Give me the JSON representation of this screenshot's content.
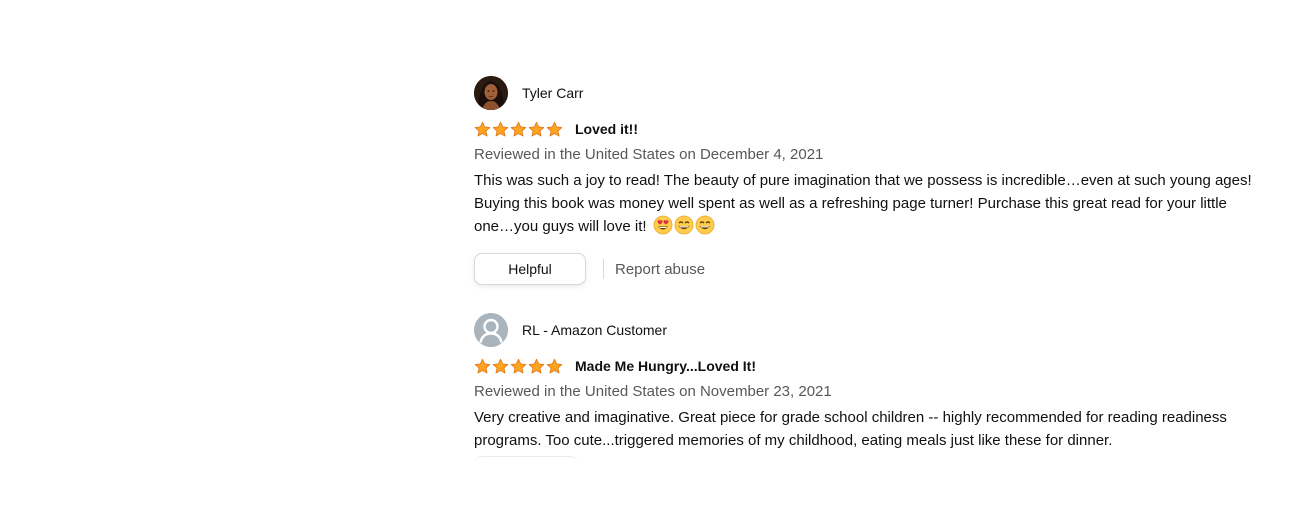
{
  "colors": {
    "star": "#FFA41C",
    "star_outline": "#DE7921",
    "text": "#0F1111",
    "secondary_text": "#565959"
  },
  "reviews": [
    {
      "author": "Tyler Carr",
      "avatar": "profile-photo",
      "rating": 5,
      "title": "Loved it!!",
      "date": "Reviewed in the United States on December 4, 2021",
      "body": "This was such a joy to read! The beauty of pure imagination that we possess is incredible…even at such young ages! Buying this book was money well spent as well as a refreshing page turner! Purchase this great read for your little one…you guys will love it! ",
      "emojis": [
        "heart-eyes-emoji",
        "grinning-emoji",
        "grinning-emoji"
      ],
      "helpful_label": "Helpful",
      "report_label": "Report abuse"
    },
    {
      "author": "RL - Amazon Customer",
      "avatar": "default-avatar-icon",
      "rating": 5,
      "title": "Made Me Hungry...Loved It!",
      "date": "Reviewed in the United States on November 23, 2021",
      "body": "Very creative and imaginative. Great piece for grade school children -- highly recommended for reading readiness programs. Too cute...triggered memories of my childhood, eating meals just like these for dinner."
    }
  ]
}
